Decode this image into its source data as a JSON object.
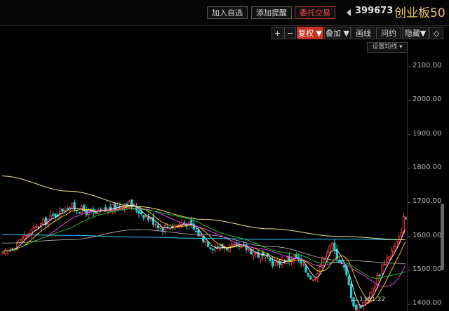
{
  "header": {
    "add_watchlist": "加入自选",
    "add_alert": "添加提醒",
    "trade": "委托交易",
    "code": "399673",
    "name": "创业板50"
  },
  "toolbar": {
    "zoom_in": "+",
    "zoom_out": "−",
    "adjust": "复权",
    "overlay": "叠加",
    "draw": "画线",
    "question": "问约",
    "hide": "隐藏",
    "settings_ma": "设置均线"
  },
  "colors": {
    "up": "#ff3b3b",
    "down": "#25d1d1",
    "ma5": "#ffffff",
    "ma10": "#ffd700",
    "ma20": "#ff44ff",
    "ma30": "#22cc22",
    "ma60": "#aaaaaa",
    "ma120": "#2fc8ff",
    "ma250": "#f0e68c"
  },
  "chart_data": {
    "type": "candlestick",
    "y_ticks": [
      "2100.00",
      "2000.00",
      "1900.00",
      "1800.00",
      "1700.00",
      "1600.00",
      "1500.00",
      "1400.00"
    ],
    "min_label": "1361.22",
    "ylim": [
      1380,
      2160
    ],
    "ma250": [
      1778,
      1733,
      1688,
      1650,
      1622,
      1600,
      1590
    ],
    "ma120": [
      1605,
      1603,
      1598,
      1594,
      1591,
      1592,
      1590
    ],
    "ma60": [
      1580,
      1590,
      1620,
      1605,
      1570,
      1530,
      1520
    ]
  }
}
